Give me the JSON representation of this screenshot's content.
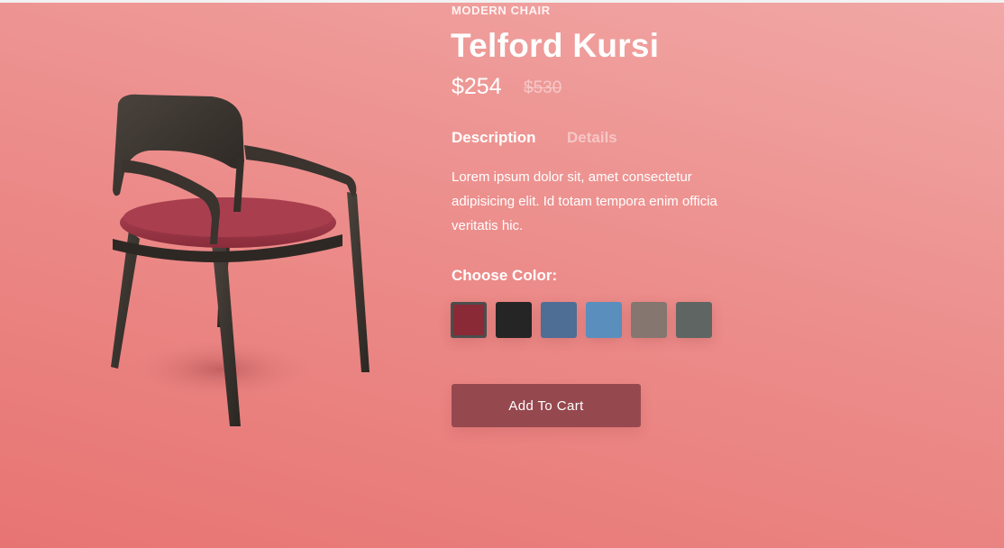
{
  "product": {
    "category": "MODERN CHAIR",
    "name": "Telford Kursi",
    "price": "$254",
    "old_price": "$530"
  },
  "tabs": {
    "description": "Description",
    "details": "Details",
    "active": "description"
  },
  "description_text": "Lorem ipsum dolor sit, amet consectetur adipisicing elit. Id totam tempora enim officia veritatis hic.",
  "color_picker": {
    "label": "Choose Color:",
    "selected_index": 0,
    "swatches": [
      {
        "name": "burgundy",
        "color": "#8a2a36"
      },
      {
        "name": "black",
        "color": "#252525"
      },
      {
        "name": "denim-blue",
        "color": "#4f6e95"
      },
      {
        "name": "sky-blue",
        "color": "#5a8fbd"
      },
      {
        "name": "taupe",
        "color": "#857770"
      },
      {
        "name": "slate-gray",
        "color": "#5f6562"
      }
    ]
  },
  "cart_button": {
    "label": "Add To Cart"
  },
  "colors": {
    "background_top": "#f1a8a6",
    "background_bottom": "#e77472",
    "button": "#96484f",
    "text": "#ffffff"
  }
}
